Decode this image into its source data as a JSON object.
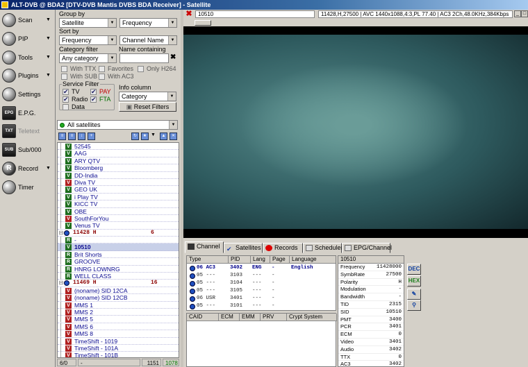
{
  "window": {
    "title": "ALT-DVB @ BDA2 [DTV-DVB Mantis DVBS BDA Receiver] - Satellite"
  },
  "sidebar": {
    "items": [
      {
        "label": "Scan",
        "icon": "satellite-dish-icon",
        "arrow": true
      },
      {
        "label": "PIP",
        "icon": "pip-icon",
        "arrow": true
      },
      {
        "label": "Tools",
        "icon": "tools-icon",
        "arrow": true
      },
      {
        "label": "Plugins",
        "icon": "plugins-icon",
        "arrow": true
      },
      {
        "label": "Settings",
        "icon": "settings-icon",
        "arrow": false
      },
      {
        "label": "E.P.G.",
        "icon": "epg-icon",
        "arrow": false
      },
      {
        "label": "Teletext",
        "icon": "teletext-icon",
        "arrow": false,
        "disabled": true
      },
      {
        "label": "Sub/000",
        "icon": "subtitles-icon",
        "arrow": false
      },
      {
        "label": "Record",
        "icon": "record-icon",
        "arrow": true
      },
      {
        "label": "Timer",
        "icon": "timer-icon",
        "arrow": false
      }
    ]
  },
  "filters": {
    "group_by_label": "Group by",
    "group_by": "Satellite",
    "group_by2": "Frequency",
    "sort_by_label": "Sort by",
    "sort_by": "Frequency",
    "sort_by2": "Channel Name",
    "category_filter_label": "Category filter",
    "category_filter": "Any category",
    "name_containing_label": "Name containing",
    "name_containing": "",
    "with_ttx": "With TTX",
    "with_sub": "With SUB",
    "favorites": "Favorites",
    "with_ac3": "With AC3",
    "only_h264": "Only H264",
    "service_filter_label": "Service Filter",
    "tv": "TV",
    "radio": "Radio",
    "data": "Data",
    "pay": "PAY",
    "fta": "FTA",
    "info_column_label": "Info column",
    "info_column": "Category",
    "reset_filters": "Reset Filters"
  },
  "satellite_select": "All satellites",
  "channels": [
    {
      "kind": "ch",
      "badge": "V",
      "name": "52545",
      "color": "g"
    },
    {
      "kind": "ch",
      "badge": "V",
      "name": "AAG",
      "color": "g"
    },
    {
      "kind": "ch",
      "badge": "V",
      "name": "ARY QTV",
      "color": "g"
    },
    {
      "kind": "ch",
      "badge": "V",
      "name": "Bloomberg",
      "color": "g"
    },
    {
      "kind": "ch",
      "badge": "V",
      "name": "DD-India",
      "color": "g"
    },
    {
      "kind": "ch",
      "badge": "V",
      "name": "Diva TV",
      "color": "r"
    },
    {
      "kind": "ch",
      "badge": "V",
      "name": "GEO UK",
      "color": "g"
    },
    {
      "kind": "ch",
      "badge": "V",
      "name": "i Play TV",
      "color": "g"
    },
    {
      "kind": "ch",
      "badge": "V",
      "name": "KICC TV",
      "color": "g"
    },
    {
      "kind": "ch",
      "badge": "V",
      "name": "OBE",
      "color": "g"
    },
    {
      "kind": "ch",
      "badge": "V",
      "name": "SouthForYou",
      "color": "r"
    },
    {
      "kind": "ch",
      "badge": "V",
      "name": "Venus TV",
      "color": "g"
    },
    {
      "kind": "tp",
      "name": "11428 H",
      "count": "6"
    },
    {
      "kind": "ch",
      "badge": "R",
      "name": "-",
      "color": "g"
    },
    {
      "kind": "ch",
      "badge": "V",
      "name": "10510",
      "color": "g",
      "selected": true
    },
    {
      "kind": "ch",
      "badge": "R",
      "name": "Brit Shorts",
      "color": "g"
    },
    {
      "kind": "ch",
      "badge": "R",
      "name": "GROOVE",
      "color": "g"
    },
    {
      "kind": "ch",
      "badge": "R",
      "name": "HNRG LOWNRG",
      "color": "g"
    },
    {
      "kind": "ch",
      "badge": "R",
      "name": "WELL CLASS",
      "color": "g"
    },
    {
      "kind": "tp",
      "name": "11469 H",
      "count": "16"
    },
    {
      "kind": "ch",
      "badge": "V",
      "name": "(noname) SID 12CA",
      "color": "r"
    },
    {
      "kind": "ch",
      "badge": "V",
      "name": "(noname) SID 12CB",
      "color": "r"
    },
    {
      "kind": "ch",
      "badge": "V",
      "name": "MMS 1",
      "color": "r"
    },
    {
      "kind": "ch",
      "badge": "V",
      "name": "MMS 2",
      "color": "r"
    },
    {
      "kind": "ch",
      "badge": "V",
      "name": "MMS 5",
      "color": "r"
    },
    {
      "kind": "ch",
      "badge": "V",
      "name": "MMS 6",
      "color": "r"
    },
    {
      "kind": "ch",
      "badge": "V",
      "name": "MMS 8",
      "color": "r"
    },
    {
      "kind": "ch",
      "badge": "V",
      "name": "TimeShift - 1019",
      "color": "r"
    },
    {
      "kind": "ch",
      "badge": "V",
      "name": "TimeShift - 101A",
      "color": "r"
    },
    {
      "kind": "ch",
      "badge": "V",
      "name": "TimeShift - 101B",
      "color": "r"
    }
  ],
  "list_status": {
    "pos": "6/0",
    "sep": "-",
    "total": "1151",
    "count": "1078"
  },
  "video": {
    "channel": "10510",
    "info": "11428,H,27500 | AVC 1440x1088,4:3,PL 77.40 | AC3 2Ch,48.0KHz,384Kbps"
  },
  "tabs": [
    "Channel",
    "Satellites",
    "Records",
    "Scheduler",
    "EPG/Channel"
  ],
  "pid_table": {
    "headers": [
      "Type",
      "PID",
      "Lang",
      "Page",
      "Language"
    ],
    "rows": [
      {
        "type": "06 AC3",
        "pid": "3402",
        "lang": "ENG",
        "page": "-",
        "language": "English",
        "hl": true
      },
      {
        "type": "05 ---",
        "pid": "3103",
        "lang": "---",
        "page": "-",
        "language": ""
      },
      {
        "type": "05 ---",
        "pid": "3104",
        "lang": "---",
        "page": "-",
        "language": ""
      },
      {
        "type": "05 ---",
        "pid": "3105",
        "lang": "---",
        "page": "-",
        "language": ""
      },
      {
        "type": "06 USR",
        "pid": "3401",
        "lang": "---",
        "page": "-",
        "language": ""
      },
      {
        "type": "05 ---",
        "pid": "3101",
        "lang": "---",
        "page": "-",
        "language": ""
      }
    ]
  },
  "caid_table": {
    "headers": [
      "CAID",
      "ECM",
      "EMM",
      "PRV",
      "Crypt System"
    ]
  },
  "info": {
    "header": "10510",
    "rows": [
      {
        "k": "Frequency",
        "v": "11428000"
      },
      {
        "k": "SymbRate",
        "v": "27500"
      },
      {
        "k": "Polarity",
        "v": "H"
      },
      {
        "k": "Modulation",
        "v": "-"
      },
      {
        "k": "Bandwidth",
        "v": "-"
      },
      {
        "k": "TID",
        "v": "2315"
      },
      {
        "k": "SID",
        "v": "10510"
      },
      {
        "k": "PMT",
        "v": "3400"
      },
      {
        "k": "PCR",
        "v": "3401"
      },
      {
        "k": "ECM",
        "v": "0"
      },
      {
        "k": "Video",
        "v": "3401"
      },
      {
        "k": "Audio",
        "v": "3402"
      },
      {
        "k": "TTX",
        "v": "0"
      },
      {
        "k": "AC3",
        "v": "3402"
      }
    ]
  },
  "side_buttons": {
    "dec": "DEC",
    "hex": "HEX"
  }
}
